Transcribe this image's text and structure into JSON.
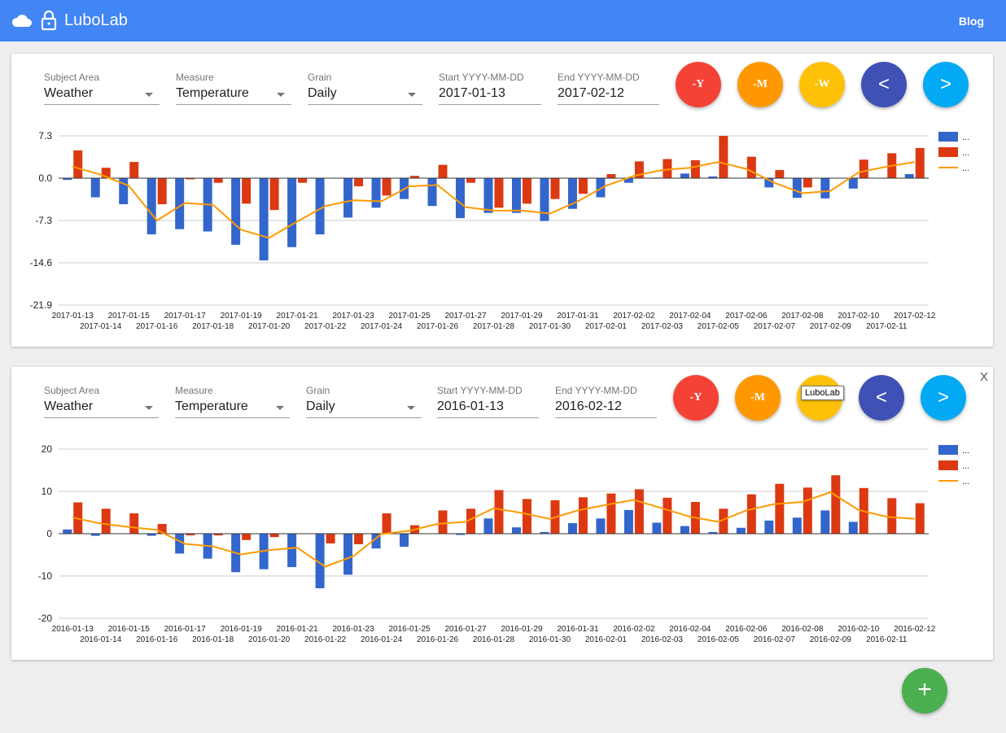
{
  "appbar": {
    "title": "LuboLab",
    "blog_label": "Blog",
    "color": "#4285f4"
  },
  "panels": [
    {
      "subject_area": {
        "label": "Subject Area",
        "value": "Weather"
      },
      "measure": {
        "label": "Measure",
        "value": "Temperature"
      },
      "grain": {
        "label": "Grain",
        "value": "Daily"
      },
      "start": {
        "label": "Start YYYY-MM-DD",
        "value": "2017-01-13"
      },
      "end": {
        "label": "End YYYY-MM-DD",
        "value": "2017-02-12"
      },
      "buttons": {
        "year": "-Y",
        "month": "-M",
        "week": "-W",
        "prev": "<",
        "next": ">"
      },
      "chart_data": {
        "type": "bar",
        "ylim": [
          -21.9,
          7.3
        ],
        "yticks": [
          "7.3",
          "0.0",
          "-7.3",
          "-14.6",
          "-21.9"
        ],
        "ytick_values": [
          7.3,
          0,
          -7.3,
          -14.6,
          -21.9
        ],
        "categories": [
          "2017-01-13",
          "2017-01-14",
          "2017-01-15",
          "2017-01-16",
          "2017-01-17",
          "2017-01-18",
          "2017-01-19",
          "2017-01-20",
          "2017-01-21",
          "2017-01-22",
          "2017-01-23",
          "2017-01-24",
          "2017-01-25",
          "2017-01-26",
          "2017-01-27",
          "2017-01-28",
          "2017-01-29",
          "2017-01-30",
          "2017-01-31",
          "2017-02-01",
          "2017-02-02",
          "2017-02-03",
          "2017-02-04",
          "2017-02-05",
          "2017-02-06",
          "2017-02-07",
          "2017-02-08",
          "2017-02-09",
          "2017-02-10",
          "2017-02-11",
          "2017-02-12"
        ],
        "legend": [
          "...",
          "...",
          "..."
        ],
        "series": [
          {
            "color": "#3366cc",
            "kind": "bar",
            "values": [
              -0.3,
              -3.3,
              -4.5,
              -9.7,
              -8.8,
              -9.2,
              -11.5,
              -14.2,
              -11.9,
              -9.7,
              -6.8,
              -5.1,
              -3.6,
              -4.8,
              -6.9,
              -6.0,
              -6.0,
              -7.4,
              -5.3,
              -3.3,
              -0.8,
              0.1,
              0.8,
              0.3,
              0.0,
              -1.6,
              -3.4,
              -3.5,
              -1.8,
              0.0,
              0.7
            ]
          },
          {
            "color": "#dc3912",
            "kind": "bar",
            "values": [
              4.8,
              1.8,
              2.8,
              -4.5,
              -0.2,
              -0.8,
              -4.4,
              -5.5,
              -0.8,
              0.0,
              -1.4,
              -3.0,
              0.4,
              2.3,
              -0.8,
              -5.1,
              -4.4,
              -3.6,
              -2.7,
              0.7,
              2.9,
              3.3,
              3.1,
              7.3,
              3.7,
              1.4,
              -1.6,
              0.0,
              3.2,
              4.3,
              5.2
            ]
          },
          {
            "color": "#ff9900",
            "kind": "line",
            "values": [
              2.0,
              0.6,
              -1.3,
              -7.3,
              -4.3,
              -4.6,
              -8.9,
              -10.3,
              -7.5,
              -4.8,
              -3.8,
              -4.0,
              -1.4,
              -1.2,
              -5.0,
              -5.6,
              -5.6,
              -6.1,
              -4.0,
              -1.3,
              0.4,
              1.4,
              1.8,
              2.8,
              1.6,
              -0.8,
              -2.6,
              -2.2,
              1.0,
              2.0,
              2.8
            ]
          }
        ]
      }
    },
    {
      "subject_area": {
        "label": "Subject Area",
        "value": "Weather"
      },
      "measure": {
        "label": "Measure",
        "value": "Temperature"
      },
      "grain": {
        "label": "Grain",
        "value": "Daily"
      },
      "start": {
        "label": "Start YYYY-MM-DD",
        "value": "2016-01-13"
      },
      "end": {
        "label": "End YYYY-MM-DD",
        "value": "2016-02-12"
      },
      "buttons": {
        "year": "-Y",
        "month": "-M",
        "prev": "<",
        "next": ">"
      },
      "close_label": "X",
      "tooltip": "LuboLab",
      "chart_data": {
        "type": "bar",
        "ylim": [
          -20,
          20
        ],
        "yticks": [
          "20",
          "10",
          "0",
          "-10",
          "-20"
        ],
        "ytick_values": [
          20,
          10,
          0,
          -10,
          -20
        ],
        "categories": [
          "2016-01-13",
          "2016-01-14",
          "2016-01-15",
          "2016-01-16",
          "2016-01-17",
          "2016-01-18",
          "2016-01-19",
          "2016-01-20",
          "2016-01-21",
          "2016-01-22",
          "2016-01-23",
          "2016-01-24",
          "2016-01-25",
          "2016-01-26",
          "2016-01-27",
          "2016-01-28",
          "2016-01-29",
          "2016-01-30",
          "2016-01-31",
          "2016-02-01",
          "2016-02-02",
          "2016-02-03",
          "2016-02-04",
          "2016-02-05",
          "2016-02-06",
          "2016-02-07",
          "2016-02-08",
          "2016-02-09",
          "2016-02-10",
          "2016-02-11",
          "2016-02-12"
        ],
        "legend": [
          "...",
          "...",
          "..."
        ],
        "series": [
          {
            "color": "#3366cc",
            "kind": "bar",
            "values": [
              1.0,
              -0.5,
              0.0,
              -0.5,
              -4.7,
              -5.9,
              -9.1,
              -8.4,
              -7.9,
              -12.9,
              -9.7,
              -3.5,
              -3.1,
              0.1,
              -0.3,
              3.6,
              1.5,
              0.4,
              2.5,
              3.6,
              5.6,
              2.6,
              1.8,
              0.4,
              1.4,
              3.1,
              3.8,
              5.5,
              2.8,
              0.0,
              0.0
            ]
          },
          {
            "color": "#dc3912",
            "kind": "bar",
            "values": [
              7.4,
              5.9,
              4.8,
              2.3,
              -0.4,
              -0.4,
              -1.5,
              -0.8,
              0.0,
              -2.3,
              -2.5,
              4.8,
              2.0,
              5.5,
              5.9,
              10.3,
              8.2,
              7.9,
              8.6,
              9.5,
              10.5,
              8.5,
              7.5,
              5.9,
              9.3,
              11.8,
              10.9,
              13.8,
              10.8,
              8.4,
              7.2
            ]
          },
          {
            "color": "#ff9900",
            "kind": "line",
            "values": [
              3.8,
              2.4,
              1.6,
              0.9,
              -2.4,
              -3.0,
              -4.9,
              -3.9,
              -3.3,
              -7.8,
              -5.3,
              -0.1,
              0.7,
              2.3,
              2.8,
              6.0,
              4.9,
              3.5,
              5.5,
              6.8,
              8.0,
              6.0,
              4.0,
              2.8,
              5.5,
              7.0,
              7.5,
              9.8,
              5.6,
              4.0,
              3.5
            ]
          }
        ]
      }
    }
  ],
  "add_button_label": "+"
}
